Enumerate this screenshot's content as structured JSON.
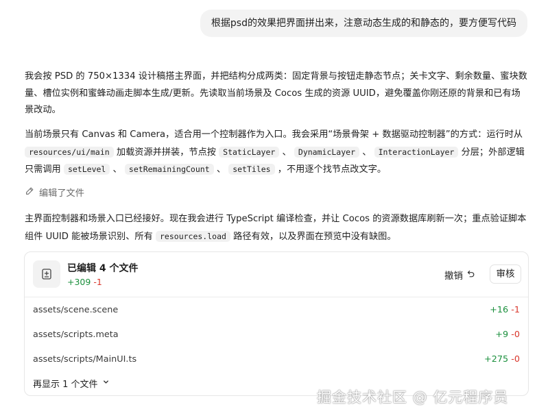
{
  "user_message": "根据psd的效果把界面拼出来，注意动态生成的和静态的，要方便写代码",
  "assistant": {
    "p1": "我会按 PSD 的 750×1334 设计稿搭主界面，并把结构分成两类：固定背景与按钮走静态节点；关卡文字、剩余数量、蜜块数量、槽位实例和蜜蜂动画走脚本生成/更新。先读取当前场景及 Cocos 生成的资源 UUID，避免覆盖你刚还原的背景和已有场景改动。",
    "p2_a": "当前场景只有 Canvas 和 Camera，适合用一个控制器作为入口。我会采用“场景骨架 + 数据驱动控制器”的方式：运行时从 ",
    "p2_code1": "resources/ui/main",
    "p2_b": " 加载资源并拼装，节点按 ",
    "p2_code2": "StaticLayer",
    "p2_sep1": " 、 ",
    "p2_code3": "DynamicLayer",
    "p2_sep2": " 、 ",
    "p2_code4": "InteractionLayer",
    "p2_c": " 分层；外部逻辑只需调用 ",
    "p2_code5": "setLevel",
    "p2_sep3": " 、 ",
    "p2_code6": "setRemainingCount",
    "p2_sep4": " 、 ",
    "p2_code7": "setTiles",
    "p2_d": " ，不用逐个找节点改文字。",
    "edited_file_label": "编辑了文件",
    "p4_a": "主界面控制器和场景入口已经接好。现在我会进行 TypeScript 编译检查，并让 Cocos 的资源数据库刷新一次；重点验证脚本组件 UUID 能被场景识别、所有 ",
    "p4_code": "resources.load",
    "p4_b": " 路径有效，以及界面在预览中没有缺图。"
  },
  "card": {
    "title": "已编辑 4 个文件",
    "added": "+309",
    "removed": "-1",
    "undo_label": "撤销",
    "review_label": "审核",
    "files": [
      {
        "path": "assets/scene.scene",
        "added": "+16",
        "removed": "-1"
      },
      {
        "path": "assets/scripts.meta",
        "added": "+9",
        "removed": "-0"
      },
      {
        "path": "assets/scripts/MainUI.ts",
        "added": "+275",
        "removed": "-0"
      }
    ],
    "show_more": "再显示 1 个文件"
  },
  "watermark": "掘金技术社区 @ 亿元程序员",
  "colors": {
    "added": "#1a8f3c",
    "removed": "#d9362b",
    "bubble": "#f3f3f3"
  }
}
